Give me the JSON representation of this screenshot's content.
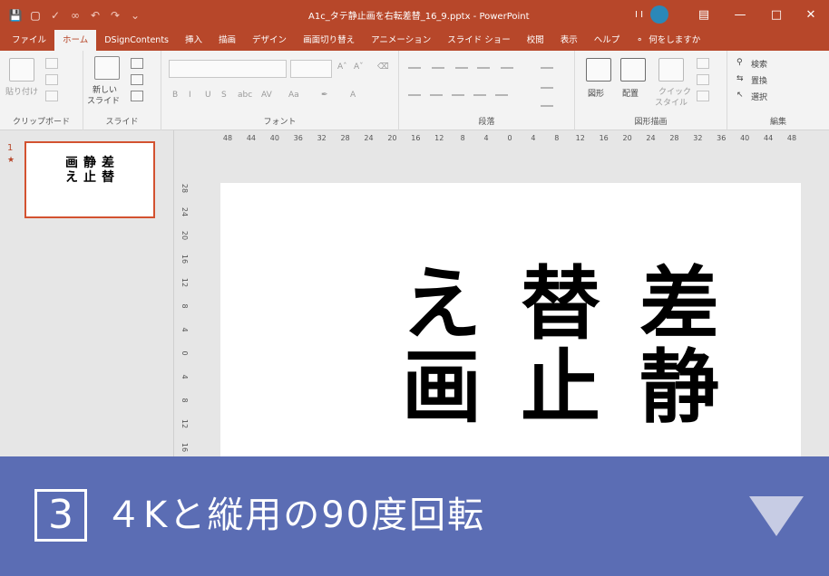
{
  "titlebar": {
    "doc_title": "A1c_タテ静止画を右転差替_16_9.pptx - PowerPoint",
    "user_initials": "I I",
    "colors": {
      "accent": "#b7472a",
      "avatar": "#2b88b8"
    }
  },
  "tabs": [
    {
      "label": "ファイル"
    },
    {
      "label": "ホーム"
    },
    {
      "label": "DSignContents"
    },
    {
      "label": "挿入"
    },
    {
      "label": "描画"
    },
    {
      "label": "デザイン"
    },
    {
      "label": "画面切り替え"
    },
    {
      "label": "アニメーション"
    },
    {
      "label": "スライド ショー"
    },
    {
      "label": "校閲"
    },
    {
      "label": "表示"
    },
    {
      "label": "ヘルプ"
    },
    {
      "label": "何をしますか"
    }
  ],
  "ribbon": {
    "clipboard": {
      "label": "クリップボード",
      "paste": "貼り付け"
    },
    "slides": {
      "label": "スライド",
      "new_slide_1": "新しい",
      "new_slide_2": "スライド"
    },
    "font": {
      "label": "フォント"
    },
    "paragraph": {
      "label": "段落"
    },
    "drawing": {
      "label": "図形描画",
      "shapes": "図形",
      "arrange": "配置",
      "quick_1": "クイック",
      "quick_2": "スタイル"
    },
    "editing": {
      "label": "編集",
      "find": "検索",
      "replace": "置換",
      "select": "選択"
    }
  },
  "thumbnail": {
    "slide_number": "1",
    "star": "★",
    "columns": [
      [
        "差",
        "替"
      ],
      [
        "静",
        "止"
      ],
      [
        "画",
        "え"
      ]
    ]
  },
  "ruler": {
    "h_ticks": [
      "48",
      "44",
      "40",
      "36",
      "32",
      "28",
      "24",
      "20",
      "16",
      "12",
      "8",
      "4",
      "0",
      "4",
      "8",
      "12",
      "16",
      "20",
      "24",
      "28",
      "32",
      "36",
      "40",
      "44",
      "48"
    ],
    "v_ticks": [
      "28",
      "24",
      "20",
      "16",
      "12",
      "8",
      "4",
      "0",
      "4",
      "8",
      "12",
      "16"
    ]
  },
  "slide": {
    "columns": [
      {
        "chars": [
          "差",
          "静"
        ]
      },
      {
        "chars": [
          "替",
          "止"
        ]
      },
      {
        "chars": [
          "え",
          "画"
        ]
      }
    ]
  },
  "banner": {
    "step": "3",
    "title": "４Kと縦用の90度回転",
    "color": "#5b6db4"
  }
}
